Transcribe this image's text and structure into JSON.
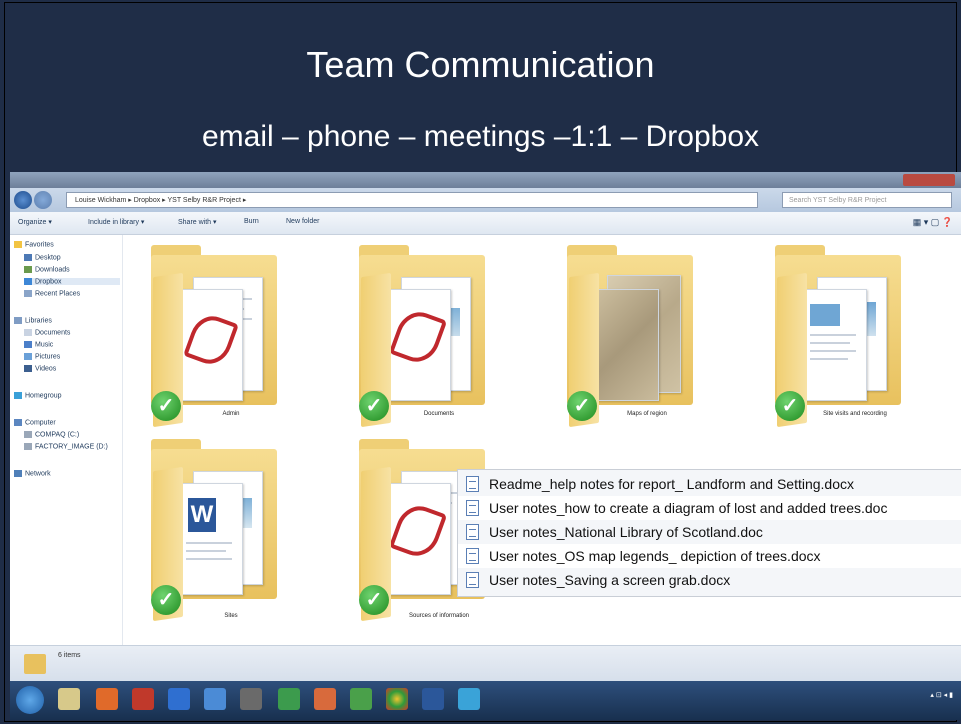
{
  "slide": {
    "title": "Team Communication",
    "subtitle": "email – phone – meetings –1:1 – Dropbox"
  },
  "explorer": {
    "breadcrumb": "Louise Wickham ▸ Dropbox ▸ YST Selby R&R Project ▸",
    "search_placeholder": "Search YST Selby R&R Project",
    "toolbar": [
      "Organize ▾",
      "Include in library ▾",
      "Share with ▾",
      "Burn",
      "New folder"
    ],
    "sidebar": {
      "favorites_header": "Favorites",
      "favorites": [
        "Desktop",
        "Downloads",
        "Dropbox",
        "Recent Places"
      ],
      "libraries_header": "Libraries",
      "libraries": [
        "Documents",
        "Music",
        "Pictures",
        "Videos"
      ],
      "homegroup": "Homegroup",
      "computer_header": "Computer",
      "drives": [
        "COMPAQ (C:)",
        "FACTORY_IMAGE (D:)"
      ],
      "network": "Network"
    },
    "folders": [
      {
        "name": "Admin"
      },
      {
        "name": "Documents"
      },
      {
        "name": "Maps of region"
      },
      {
        "name": "Site visits and recording"
      },
      {
        "name": "Sites"
      },
      {
        "name": "Sources of information"
      }
    ],
    "status_text": "6 items"
  },
  "popup_files": [
    "Readme_help notes for report_ Landform and Setting.docx",
    "User notes_how to create a diagram of lost and added trees.doc",
    "User notes_National Library of Scotland.doc",
    "User notes_OS map legends_ depiction of trees.docx",
    "User notes_Saving a screen grab.docx"
  ],
  "colors": {
    "slide_bg": "#1f2d47",
    "folder": "#f1d27a",
    "sync_check": "#2e9b2e"
  }
}
